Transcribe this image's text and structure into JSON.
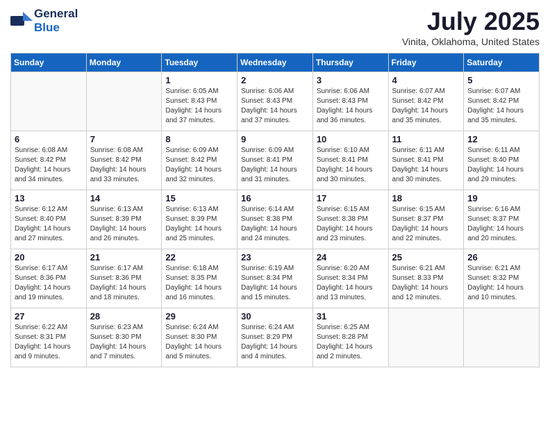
{
  "header": {
    "logo_general": "General",
    "logo_blue": "Blue",
    "month_title": "July 2025",
    "location": "Vinita, Oklahoma, United States"
  },
  "days_of_week": [
    "Sunday",
    "Monday",
    "Tuesday",
    "Wednesday",
    "Thursday",
    "Friday",
    "Saturday"
  ],
  "weeks": [
    [
      {
        "day": "",
        "info": ""
      },
      {
        "day": "",
        "info": ""
      },
      {
        "day": "1",
        "info": "Sunrise: 6:05 AM\nSunset: 8:43 PM\nDaylight: 14 hours and 37 minutes."
      },
      {
        "day": "2",
        "info": "Sunrise: 6:06 AM\nSunset: 8:43 PM\nDaylight: 14 hours and 37 minutes."
      },
      {
        "day": "3",
        "info": "Sunrise: 6:06 AM\nSunset: 8:43 PM\nDaylight: 14 hours and 36 minutes."
      },
      {
        "day": "4",
        "info": "Sunrise: 6:07 AM\nSunset: 8:42 PM\nDaylight: 14 hours and 35 minutes."
      },
      {
        "day": "5",
        "info": "Sunrise: 6:07 AM\nSunset: 8:42 PM\nDaylight: 14 hours and 35 minutes."
      }
    ],
    [
      {
        "day": "6",
        "info": "Sunrise: 6:08 AM\nSunset: 8:42 PM\nDaylight: 14 hours and 34 minutes."
      },
      {
        "day": "7",
        "info": "Sunrise: 6:08 AM\nSunset: 8:42 PM\nDaylight: 14 hours and 33 minutes."
      },
      {
        "day": "8",
        "info": "Sunrise: 6:09 AM\nSunset: 8:42 PM\nDaylight: 14 hours and 32 minutes."
      },
      {
        "day": "9",
        "info": "Sunrise: 6:09 AM\nSunset: 8:41 PM\nDaylight: 14 hours and 31 minutes."
      },
      {
        "day": "10",
        "info": "Sunrise: 6:10 AM\nSunset: 8:41 PM\nDaylight: 14 hours and 30 minutes."
      },
      {
        "day": "11",
        "info": "Sunrise: 6:11 AM\nSunset: 8:41 PM\nDaylight: 14 hours and 30 minutes."
      },
      {
        "day": "12",
        "info": "Sunrise: 6:11 AM\nSunset: 8:40 PM\nDaylight: 14 hours and 29 minutes."
      }
    ],
    [
      {
        "day": "13",
        "info": "Sunrise: 6:12 AM\nSunset: 8:40 PM\nDaylight: 14 hours and 27 minutes."
      },
      {
        "day": "14",
        "info": "Sunrise: 6:13 AM\nSunset: 8:39 PM\nDaylight: 14 hours and 26 minutes."
      },
      {
        "day": "15",
        "info": "Sunrise: 6:13 AM\nSunset: 8:39 PM\nDaylight: 14 hours and 25 minutes."
      },
      {
        "day": "16",
        "info": "Sunrise: 6:14 AM\nSunset: 8:38 PM\nDaylight: 14 hours and 24 minutes."
      },
      {
        "day": "17",
        "info": "Sunrise: 6:15 AM\nSunset: 8:38 PM\nDaylight: 14 hours and 23 minutes."
      },
      {
        "day": "18",
        "info": "Sunrise: 6:15 AM\nSunset: 8:37 PM\nDaylight: 14 hours and 22 minutes."
      },
      {
        "day": "19",
        "info": "Sunrise: 6:16 AM\nSunset: 8:37 PM\nDaylight: 14 hours and 20 minutes."
      }
    ],
    [
      {
        "day": "20",
        "info": "Sunrise: 6:17 AM\nSunset: 8:36 PM\nDaylight: 14 hours and 19 minutes."
      },
      {
        "day": "21",
        "info": "Sunrise: 6:17 AM\nSunset: 8:36 PM\nDaylight: 14 hours and 18 minutes."
      },
      {
        "day": "22",
        "info": "Sunrise: 6:18 AM\nSunset: 8:35 PM\nDaylight: 14 hours and 16 minutes."
      },
      {
        "day": "23",
        "info": "Sunrise: 6:19 AM\nSunset: 8:34 PM\nDaylight: 14 hours and 15 minutes."
      },
      {
        "day": "24",
        "info": "Sunrise: 6:20 AM\nSunset: 8:34 PM\nDaylight: 14 hours and 13 minutes."
      },
      {
        "day": "25",
        "info": "Sunrise: 6:21 AM\nSunset: 8:33 PM\nDaylight: 14 hours and 12 minutes."
      },
      {
        "day": "26",
        "info": "Sunrise: 6:21 AM\nSunset: 8:32 PM\nDaylight: 14 hours and 10 minutes."
      }
    ],
    [
      {
        "day": "27",
        "info": "Sunrise: 6:22 AM\nSunset: 8:31 PM\nDaylight: 14 hours and 9 minutes."
      },
      {
        "day": "28",
        "info": "Sunrise: 6:23 AM\nSunset: 8:30 PM\nDaylight: 14 hours and 7 minutes."
      },
      {
        "day": "29",
        "info": "Sunrise: 6:24 AM\nSunset: 8:30 PM\nDaylight: 14 hours and 5 minutes."
      },
      {
        "day": "30",
        "info": "Sunrise: 6:24 AM\nSunset: 8:29 PM\nDaylight: 14 hours and 4 minutes."
      },
      {
        "day": "31",
        "info": "Sunrise: 6:25 AM\nSunset: 8:28 PM\nDaylight: 14 hours and 2 minutes."
      },
      {
        "day": "",
        "info": ""
      },
      {
        "day": "",
        "info": ""
      }
    ]
  ]
}
